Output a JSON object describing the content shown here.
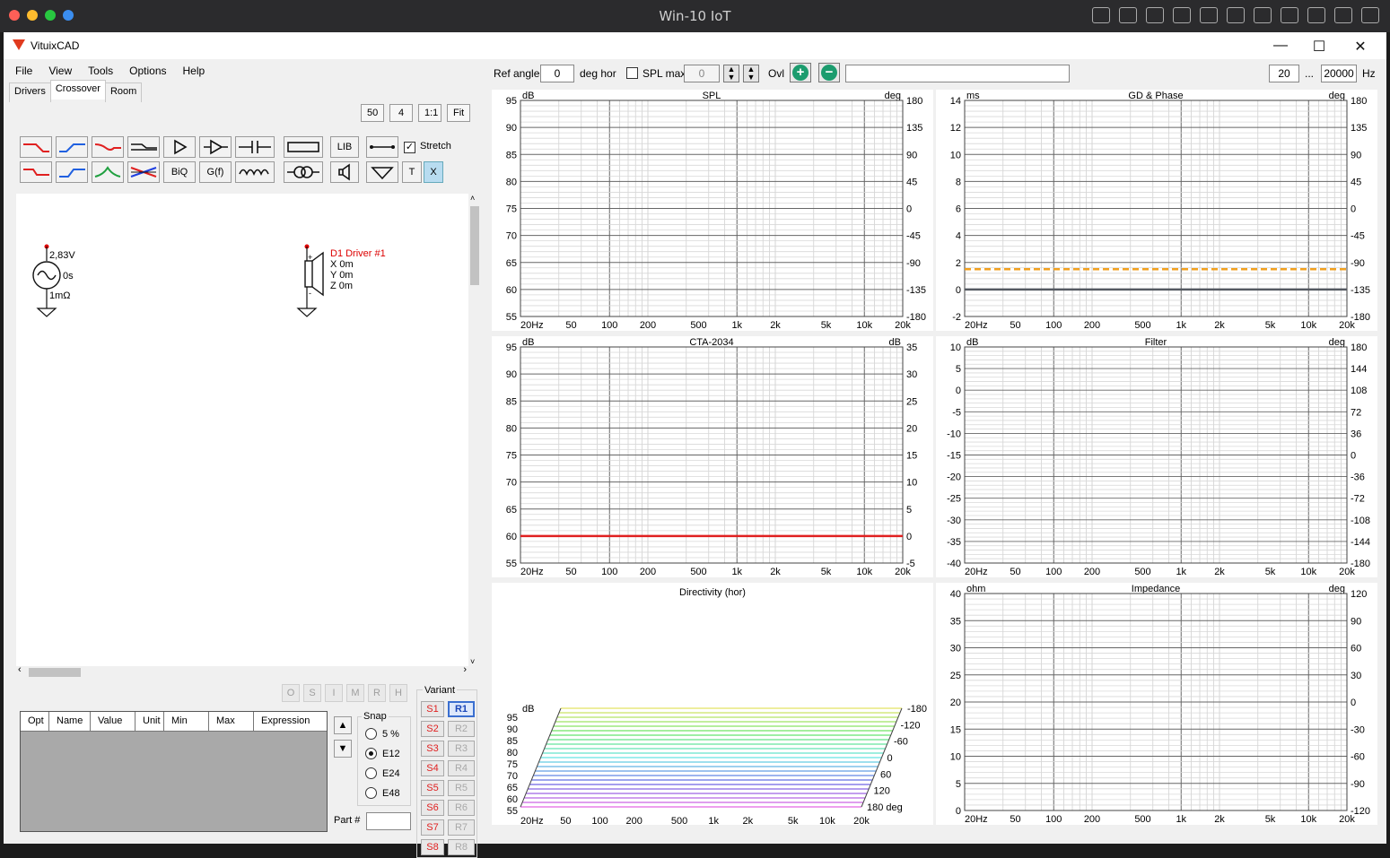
{
  "mac": {
    "title": "Win-10 IoT"
  },
  "app": {
    "title": "VituixCAD"
  },
  "menu": [
    "File",
    "View",
    "Tools",
    "Options",
    "Help"
  ],
  "tabs": [
    "Drivers",
    "Crossover",
    "Room"
  ],
  "zoom": [
    "50",
    "4",
    "1:1",
    "Fit"
  ],
  "palette": {
    "lib": "LIB",
    "biq": "BiQ",
    "gf": "G(f)",
    "t": "T",
    "x": "X",
    "stretch": "Stretch"
  },
  "schematic": {
    "source_v": "2,83V",
    "source_t": "0s",
    "source_r": "1mΩ",
    "driver_name": "D1 Driver #1",
    "driver_x": "X 0m",
    "driver_y": "Y 0m",
    "driver_z": "Z 0m"
  },
  "opt_buttons": [
    "O",
    "S",
    "I",
    "M",
    "R",
    "H"
  ],
  "param_table": {
    "columns": [
      "Opt",
      "Name",
      "Value",
      "Unit",
      "Min",
      "Max",
      "Expression"
    ]
  },
  "snap": {
    "label": "Snap",
    "options": [
      "5 %",
      "E12",
      "E24",
      "E48"
    ],
    "selected": "E12"
  },
  "part": {
    "label": "Part #",
    "value": ""
  },
  "variant": {
    "label": "Variant",
    "s": [
      "S1",
      "S2",
      "S3",
      "S4",
      "S5",
      "S6",
      "S7",
      "S8"
    ],
    "r": [
      "R1",
      "R2",
      "R3",
      "R4",
      "R5",
      "R6",
      "R7",
      "R8"
    ],
    "active": "R1"
  },
  "toolbar": {
    "ref_angle_label": "Ref angle",
    "ref_angle": "0",
    "deg_hor": "deg hor",
    "spl_max_label": "SPL max",
    "spl_max": "0",
    "ovl": "Ovl",
    "ovl_text": "",
    "f_min": "20",
    "dots": "...",
    "f_max": "20000",
    "hz": "Hz"
  },
  "chart_data": [
    {
      "type": "line",
      "title": "SPL",
      "ylabel_left": "dB",
      "ylabel_right": "deg",
      "y_left": [
        95,
        90,
        85,
        80,
        75,
        70,
        65,
        60,
        55
      ],
      "y_right": [
        "180",
        "135",
        "90",
        "45",
        "0",
        "-45",
        "-90",
        "-135",
        "-180"
      ],
      "x_ticks": [
        "20Hz",
        "50",
        "100",
        "200",
        "500",
        "1k",
        "2k",
        "5k",
        "10k",
        "20k"
      ],
      "series": []
    },
    {
      "type": "line",
      "title": "GD & Phase",
      "ylabel_left": "ms",
      "ylabel_right": "deg",
      "y_left": [
        14,
        12,
        10,
        8,
        6,
        4,
        2,
        0,
        -2
      ],
      "y_right": [
        "180",
        "135",
        "90",
        "45",
        "0",
        "-45",
        "-90",
        "-135",
        "-180"
      ],
      "x_ticks": [
        "20Hz",
        "50",
        "100",
        "200",
        "500",
        "1k",
        "2k",
        "5k",
        "10k",
        "20k"
      ],
      "series": [
        {
          "color": "#f0a020",
          "dash": true,
          "y": 1.5
        },
        {
          "color": "#555a62",
          "dash": false,
          "y": 0
        }
      ]
    },
    {
      "type": "line",
      "title": "CTA-2034",
      "ylabel_left": "dB",
      "ylabel_right": "dB",
      "y_left": [
        95,
        90,
        85,
        80,
        75,
        70,
        65,
        60,
        55
      ],
      "y_right": [
        "35",
        "30",
        "25",
        "20",
        "15",
        "10",
        "5",
        "0",
        "-5"
      ],
      "x_ticks": [
        "20Hz",
        "50",
        "100",
        "200",
        "500",
        "1k",
        "2k",
        "5k",
        "10k",
        "20k"
      ],
      "series": [
        {
          "color": "#e02020",
          "dash": false,
          "y": 60
        }
      ]
    },
    {
      "type": "line",
      "title": "Filter",
      "ylabel_left": "dB",
      "ylabel_right": "deg",
      "y_left": [
        10,
        5,
        0,
        -5,
        -10,
        -15,
        -20,
        -25,
        -30,
        -35,
        -40
      ],
      "y_right": [
        "180",
        "144",
        "108",
        "72",
        "36",
        "0",
        "-36",
        "-72",
        "-108",
        "-144",
        "-180"
      ],
      "x_ticks": [
        "20Hz",
        "50",
        "100",
        "200",
        "500",
        "1k",
        "2k",
        "5k",
        "10k",
        "20k"
      ],
      "series": []
    },
    {
      "type": "line",
      "title": "Directivity (hor)",
      "ylabel_left": "dB",
      "y_left": [
        95,
        90,
        85,
        80,
        75,
        70,
        65,
        60,
        55
      ],
      "angles": [
        "-180",
        "-120",
        "-60",
        "0",
        "60",
        "120",
        "180 deg"
      ],
      "x_ticks": [
        "20Hz",
        "50",
        "100",
        "200",
        "500",
        "1k",
        "2k",
        "5k",
        "10k",
        "20k"
      ],
      "series": []
    },
    {
      "type": "line",
      "title": "Impedance",
      "ylabel_left": "ohm",
      "ylabel_right": "deg",
      "y_left": [
        40,
        35,
        30,
        25,
        20,
        15,
        10,
        5,
        0
      ],
      "y_right": [
        "120",
        "90",
        "60",
        "30",
        "0",
        "-30",
        "-60",
        "-90",
        "-120"
      ],
      "x_ticks": [
        "20Hz",
        "50",
        "100",
        "200",
        "500",
        "1k",
        "2k",
        "5k",
        "10k",
        "20k"
      ],
      "series": []
    }
  ]
}
